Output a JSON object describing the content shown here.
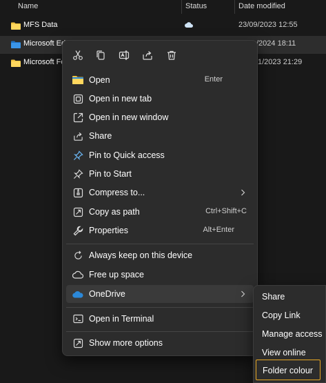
{
  "columns": {
    "name": "Name",
    "status": "Status",
    "date_modified": "Date modified"
  },
  "rows": [
    {
      "name": "MFS Data",
      "status_icon": "cloud-icon",
      "date": "23/09/2023 12:55"
    },
    {
      "name": "Microsoft Ed",
      "date": "/2024 18:11"
    },
    {
      "name": "Microsoft Fo",
      "date": "1/2023 21:29"
    }
  ],
  "quick_actions": [
    {
      "name": "cut-icon",
      "label": "Cut"
    },
    {
      "name": "copy-icon",
      "label": "Copy"
    },
    {
      "name": "rename-icon",
      "label": "Rename"
    },
    {
      "name": "share-icon",
      "label": "Share"
    },
    {
      "name": "delete-icon",
      "label": "Delete"
    }
  ],
  "menu": {
    "open": {
      "label": "Open",
      "shortcut": "Enter"
    },
    "open_new_tab": {
      "label": "Open in new tab"
    },
    "open_new_window": {
      "label": "Open in new window"
    },
    "share": {
      "label": "Share"
    },
    "pin_quick": {
      "label": "Pin to Quick access"
    },
    "pin_start": {
      "label": "Pin to Start"
    },
    "compress": {
      "label": "Compress to..."
    },
    "copy_path": {
      "label": "Copy as path",
      "shortcut": "Ctrl+Shift+C"
    },
    "properties": {
      "label": "Properties",
      "shortcut": "Alt+Enter"
    },
    "always_keep": {
      "label": "Always keep on this device"
    },
    "free_up": {
      "label": "Free up space"
    },
    "onedrive": {
      "label": "OneDrive"
    },
    "terminal": {
      "label": "Open in Terminal"
    },
    "more_options": {
      "label": "Show more options"
    }
  },
  "submenu": {
    "share": "Share",
    "copy_link": "Copy Link",
    "manage_access": "Manage access",
    "view_online": "View online",
    "folder_colour": "Folder colour"
  },
  "colors": {
    "background": "#191919",
    "menu_background": "#2c2c2c",
    "folder_yellow": "#f4c542",
    "onedrive_blue": "#2b88d8",
    "highlight_border": "#e8a823"
  }
}
